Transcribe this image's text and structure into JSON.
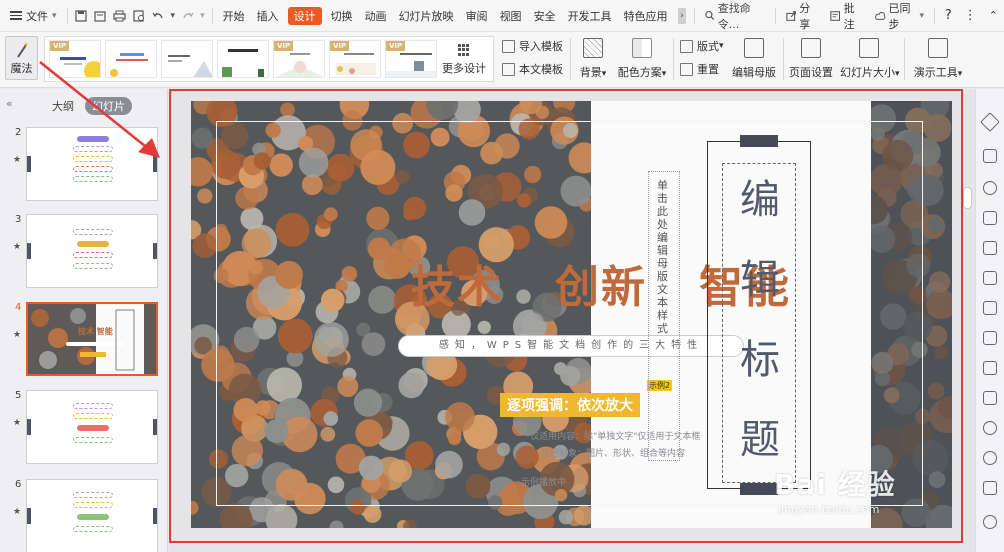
{
  "menubar": {
    "file_label": "文件",
    "tabs": [
      "开始",
      "插入",
      "设计",
      "切换",
      "动画",
      "幻灯片放映",
      "审阅",
      "视图",
      "安全",
      "开发工具",
      "特色应用"
    ],
    "active_tab": "设计",
    "search_label": "查找命令...",
    "share_label": "分享",
    "comment_label": "批注",
    "sync_label": "已同步",
    "help_label": "?"
  },
  "ribbon": {
    "magic_label": "魔法",
    "vip_badge": "VIP",
    "more_design_label": "更多设计",
    "import_template": "导入模板",
    "this_template": "本文模板",
    "background": "背景",
    "color_scheme": "配色方案",
    "layout": "版式",
    "reset": "重置",
    "edit_master": "编辑母版",
    "page_setup": "页面设置",
    "slide_size": "幻灯片大小",
    "presentation_tools": "演示工具",
    "dropdown_arrow": "▾"
  },
  "left_panel": {
    "tab_outline": "大纲",
    "tab_slides": "幻灯片",
    "slides": [
      {
        "num": "2",
        "star": "★",
        "current": false
      },
      {
        "num": "3",
        "star": "★",
        "current": false
      },
      {
        "num": "4",
        "star": "★",
        "current": true
      },
      {
        "num": "5",
        "star": "★",
        "current": false
      },
      {
        "num": "6",
        "star": "★",
        "current": false
      }
    ]
  },
  "slide": {
    "tagline_words": [
      "技术",
      "创新",
      "智能"
    ],
    "pill_text": "感知，WPS智能文档创作的三大特性",
    "gold_label": "逐项强调：依次放大",
    "example_tag": "示例2",
    "body_line1": "*仅适用内容：除\"单独文字\"仅适用于文本框",
    "body_line2": "其他对象：图片、形状、组合等内容",
    "play_note": "示例播放中",
    "vertical_text": "单击此处编辑母版文本样式",
    "title_chars": [
      "编",
      "辑",
      "标",
      "题"
    ]
  },
  "watermark": {
    "main": "Bai 经验",
    "sub": "jingyan.baidu.com"
  },
  "colors": {
    "accent": "#ea5a25",
    "highlight_frame": "#e03a3a",
    "tagline": "#c06a3b",
    "gold": "#f0b830",
    "title_dark": "#545a6e"
  }
}
